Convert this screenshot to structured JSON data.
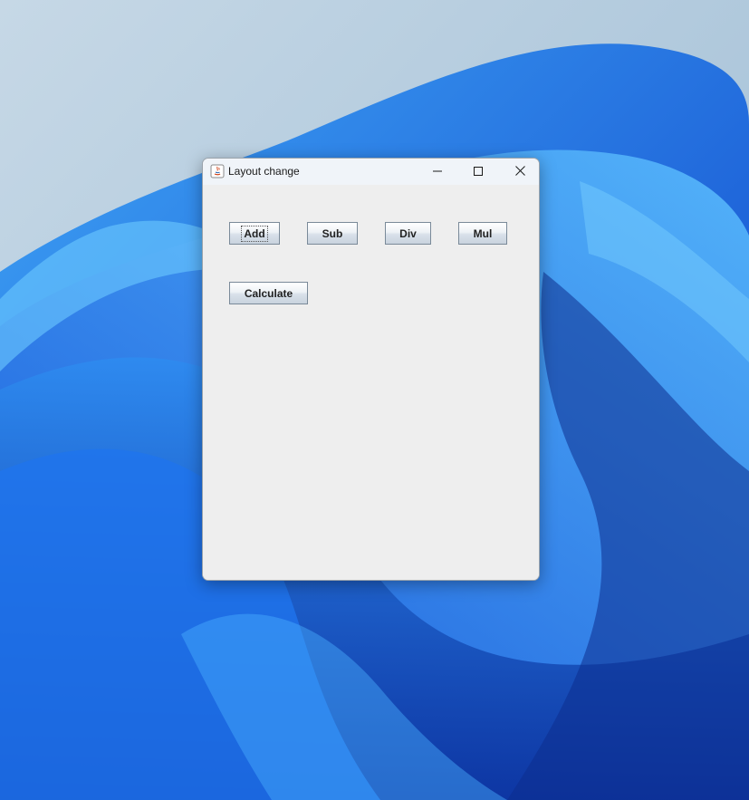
{
  "window": {
    "title": "Layout change",
    "controls": {
      "minimize": "minimize-icon",
      "maximize": "maximize-icon",
      "close": "close-icon"
    }
  },
  "buttons": {
    "add": "Add",
    "sub": "Sub",
    "div": "Div",
    "mul": "Mul",
    "calculate": "Calculate"
  },
  "colors": {
    "window_bg": "#eeeeee",
    "titlebar_bg": "#f0f4f9",
    "desktop_accent": "#1a6ae8"
  }
}
